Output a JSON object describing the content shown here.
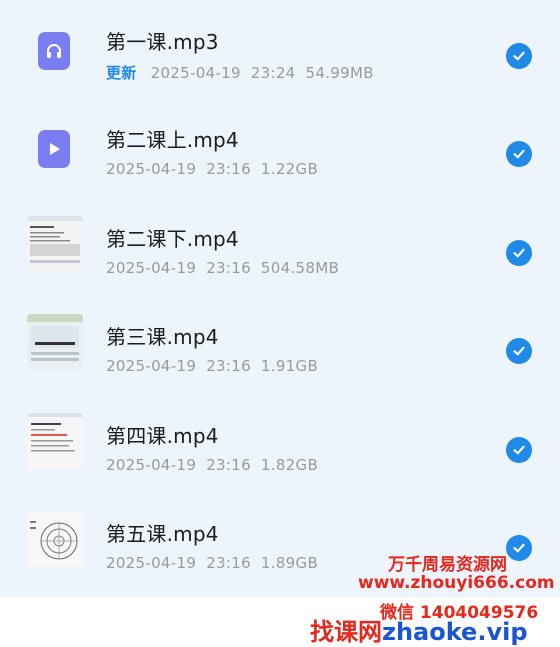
{
  "files": [
    {
      "name": "第一课.mp3",
      "badge": "更新",
      "date": "2025-04-19",
      "time": "23:24",
      "size": "54.99MB",
      "icon": "audio-file-icon",
      "selected": true
    },
    {
      "name": "第二课上.mp4",
      "date": "2025-04-19",
      "time": "23:16",
      "size": "1.22GB",
      "icon": "video-file-icon",
      "selected": true
    },
    {
      "name": "第二课下.mp4",
      "date": "2025-04-19",
      "time": "23:16",
      "size": "504.58MB",
      "icon": "video-thumbnail",
      "selected": true
    },
    {
      "name": "第三课.mp4",
      "date": "2025-04-19",
      "time": "23:16",
      "size": "1.91GB",
      "icon": "video-thumbnail",
      "selected": true
    },
    {
      "name": "第四课.mp4",
      "date": "2025-04-19",
      "time": "23:16",
      "size": "1.82GB",
      "icon": "video-thumbnail",
      "selected": true
    },
    {
      "name": "第五课.mp4",
      "date": "2025-04-19",
      "time": "23:16",
      "size": "1.89GB",
      "icon": "video-thumbnail",
      "selected": true
    }
  ],
  "watermark": {
    "line1": "万千周易资源网",
    "line2": "www.zhouyi666.com",
    "line3": "微信 1404049576",
    "line4a": "找课网",
    "line4b": "zhaoke.vip"
  },
  "colors": {
    "accent": "#1f8ae8",
    "icon": "#7b7ef0",
    "list_bg": "#eef4fb",
    "watermark": "#e8271c"
  }
}
